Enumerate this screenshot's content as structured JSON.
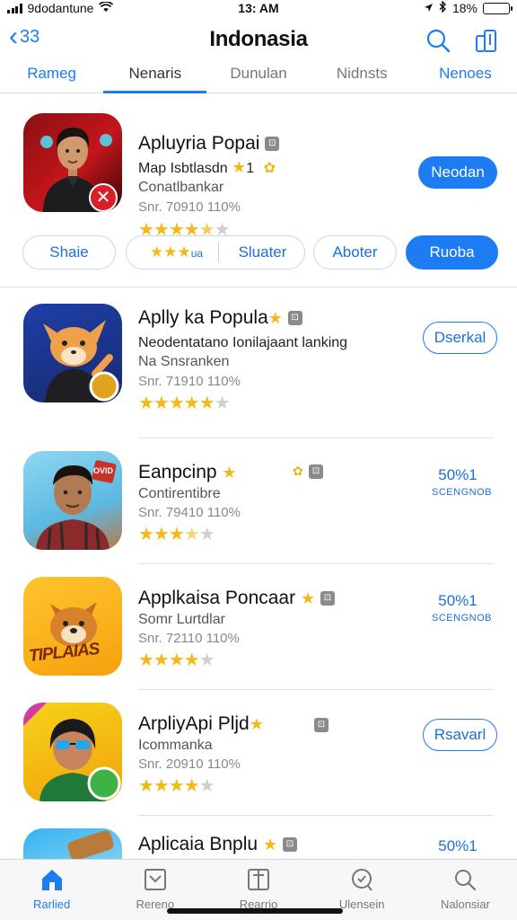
{
  "status_bar": {
    "carrier": "9dodantune",
    "time": "13: AM",
    "battery": "18%",
    "battery_level": 0.18,
    "icons": [
      "signal-icon",
      "wifi-icon",
      "location-icon",
      "bluetooth-icon",
      "battery-icon"
    ]
  },
  "nav": {
    "back_label": "33",
    "title": "Indonasia",
    "icons": [
      "search-icon",
      "share-icon"
    ]
  },
  "tabs": [
    {
      "label": "Rameg"
    },
    {
      "label": "Nenaris"
    },
    {
      "label": "Dunulan"
    },
    {
      "label": "Nidnsts"
    },
    {
      "label": "Nenoes"
    }
  ],
  "active_tab": "Nenaris",
  "featured": {
    "name": "Apluyria Popai",
    "line1": "Map Isbtlasdn",
    "line1_badge": "1",
    "line2": "Conatlbankar",
    "line3": "Snr. 70910 110%",
    "rating": 4,
    "button": "Neodan"
  },
  "chips": [
    {
      "label": "Shaie"
    },
    {
      "label": "ua"
    },
    {
      "label": "Sluater"
    },
    {
      "label": "Aboter"
    },
    {
      "label": "Ruoba"
    }
  ],
  "apps": [
    {
      "name": "Aplly ka Popula",
      "line1": "Neodentatano Ionilajaant lanking",
      "line2": "Na Snsranken",
      "line3": "Snr. 71910 110%",
      "rating": 4,
      "action": "Dserkal"
    },
    {
      "name": "Eanpcinp",
      "line1": "Contirentibre",
      "line2": "Snr. 79410 110%",
      "rating": 3.5,
      "action": "50%1",
      "action_sub": "SCENGNOB"
    },
    {
      "name": "Applkaisa Poncaar",
      "line1": "Somr Lurtdlar",
      "line2": "Snr. 72110 110%",
      "rating": 4,
      "action": "50%1",
      "action_sub": "SCENGNOB"
    },
    {
      "name": "ArpliyApi Pljd",
      "line1": "Icommanka",
      "line2": "Snr. 20910 110%",
      "rating": 4,
      "action": "Rsavarl"
    },
    {
      "name": "Aplicaia Bnplu",
      "action": "50%1"
    }
  ],
  "icon_badges": {
    "app2": "OVID",
    "app3": "TIPLAIAS"
  },
  "tab_bar": [
    {
      "label": "Rarlied",
      "icon": "house-icon"
    },
    {
      "label": "Rereno",
      "icon": "box-icon"
    },
    {
      "label": "Rearrio",
      "icon": "book-icon"
    },
    {
      "label": "Ulensein",
      "icon": "magnify-icon"
    },
    {
      "label": "Nalonsiar",
      "icon": "search-icon"
    }
  ],
  "colors": {
    "accent": "#1d7cf2",
    "star": "#f3b81a"
  }
}
